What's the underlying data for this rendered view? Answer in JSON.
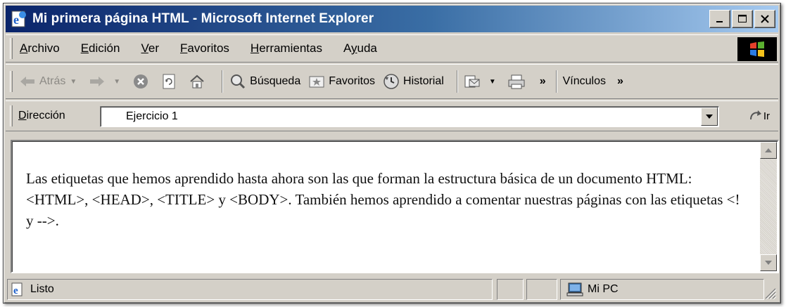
{
  "window": {
    "title": "Mi primera página HTML - Microsoft Internet Explorer"
  },
  "menubar": {
    "items": [
      {
        "label": "Archivo",
        "accel": "A"
      },
      {
        "label": "Edición",
        "accel": "E"
      },
      {
        "label": "Ver",
        "accel": "V"
      },
      {
        "label": "Favoritos",
        "accel": "F"
      },
      {
        "label": "Herramientas",
        "accel": "H"
      },
      {
        "label": "Ayuda",
        "accel": "y"
      }
    ]
  },
  "toolbar": {
    "back_label": "Atrás",
    "search_label": "Búsqueda",
    "favorites_label": "Favoritos",
    "history_label": "Historial",
    "links_label": "Vínculos",
    "overflow": "»"
  },
  "addressbar": {
    "label": "Dirección",
    "value": "Ejercicio 1",
    "go_label": "Ir"
  },
  "content": {
    "paragraph": "Las etiquetas que hemos aprendido hasta ahora son las que forman la estructura básica de un documento HTML: <HTML>, <HEAD>, <TITLE> y <BODY>. También hemos aprendido a comentar nuestras páginas con las etiquetas <! y -->."
  },
  "statusbar": {
    "status": "Listo",
    "zone": "Mi PC"
  },
  "icons": {
    "title": "ie-page-icon",
    "back": "back-arrow-icon",
    "forward": "forward-arrow-icon",
    "stop": "stop-icon",
    "refresh": "refresh-icon",
    "home": "home-icon",
    "search": "search-icon",
    "favorites": "favorites-icon",
    "history": "history-icon",
    "mail": "mail-icon",
    "print": "print-icon",
    "go": "go-arrow-icon"
  },
  "colors": {
    "titlebar_start": "#0a246a",
    "titlebar_end": "#a6caf0",
    "chrome": "#d4d0c8"
  }
}
